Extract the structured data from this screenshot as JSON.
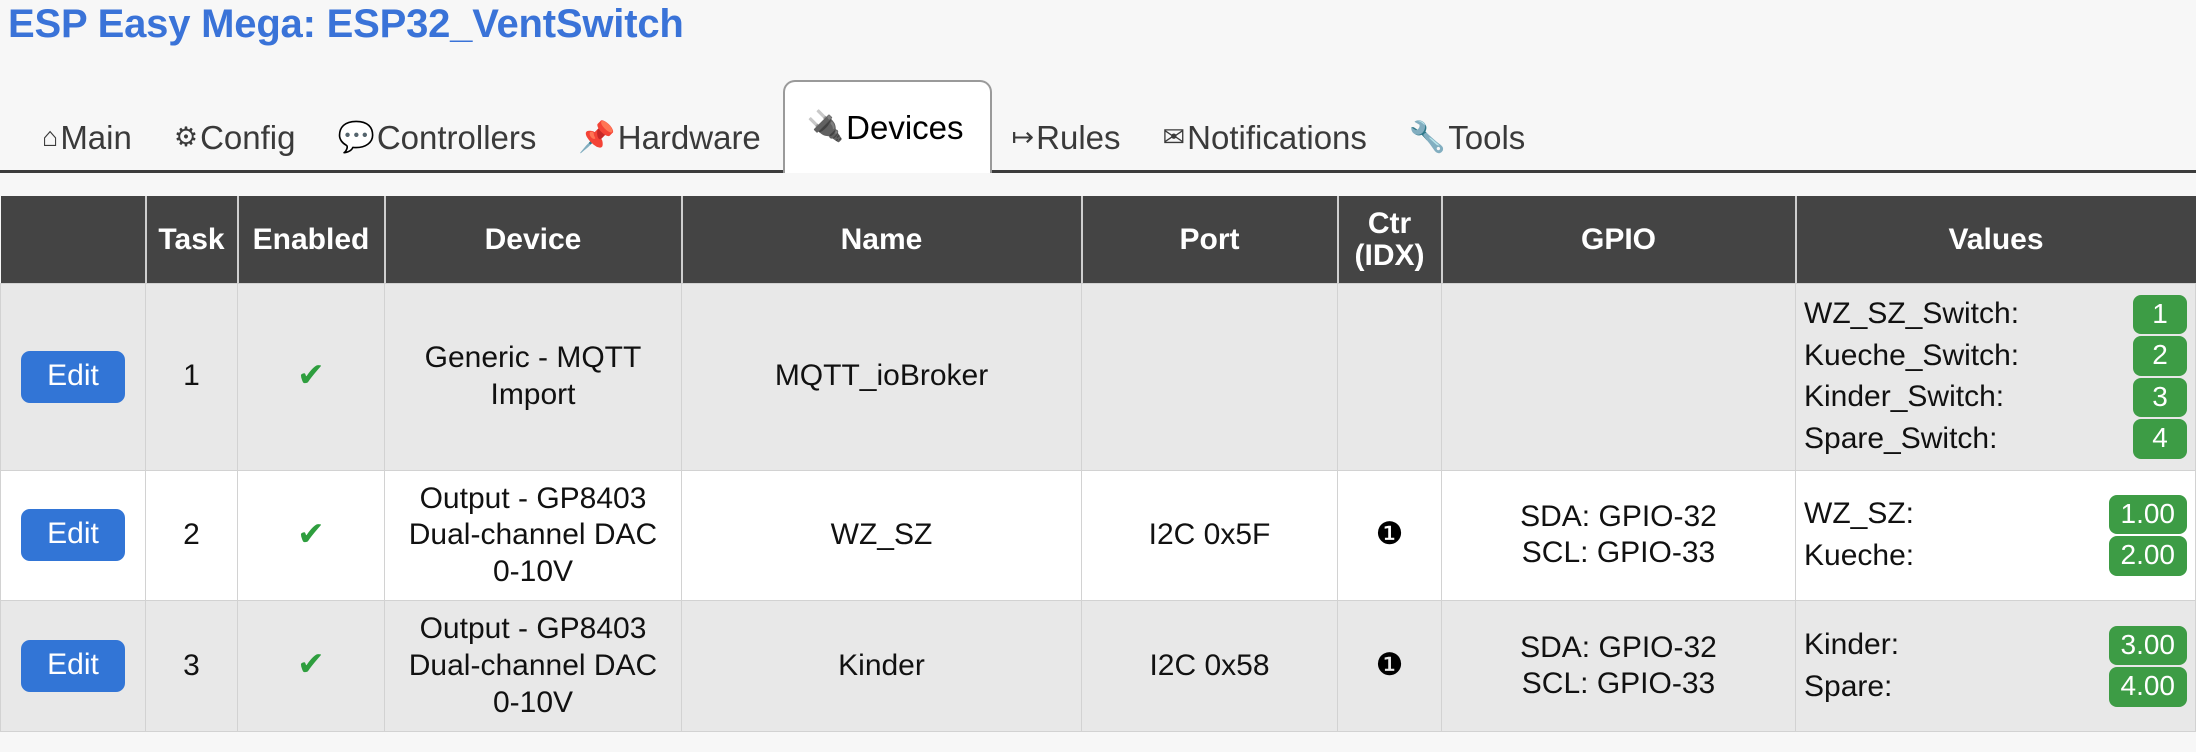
{
  "header": {
    "title": "ESP Easy Mega: ESP32_VentSwitch",
    "title_color": "#3a73d8"
  },
  "nav": {
    "tabs": [
      {
        "label": "Main",
        "icon": "home-icon",
        "glyph": "⌂",
        "active": false
      },
      {
        "label": "Config",
        "icon": "gear-icon",
        "glyph": "⚙",
        "active": false
      },
      {
        "label": "Controllers",
        "icon": "speech-bubble-icon",
        "glyph": "💬",
        "active": false
      },
      {
        "label": "Hardware",
        "icon": "pushpin-icon",
        "glyph": "📌",
        "active": false
      },
      {
        "label": "Devices",
        "icon": "electric-plug-icon",
        "glyph": "🔌",
        "active": true
      },
      {
        "label": "Rules",
        "icon": "arrow-right-icon",
        "glyph": "↦",
        "active": false
      },
      {
        "label": "Notifications",
        "icon": "envelope-icon",
        "glyph": "✉",
        "active": false
      },
      {
        "label": "Tools",
        "icon": "wrench-icon",
        "glyph": "🔧",
        "active": false
      }
    ]
  },
  "table": {
    "columns": [
      {
        "key": "edit",
        "label": ""
      },
      {
        "key": "task",
        "label": "Task"
      },
      {
        "key": "enabled",
        "label": "Enabled"
      },
      {
        "key": "device",
        "label": "Device"
      },
      {
        "key": "name",
        "label": "Name"
      },
      {
        "key": "port",
        "label": "Port"
      },
      {
        "key": "ctr",
        "label": "Ctr\n(IDX)"
      },
      {
        "key": "gpio",
        "label": "GPIO"
      },
      {
        "key": "values",
        "label": "Values"
      }
    ],
    "edit_label": "Edit",
    "enabled_glyph": "✔",
    "rows": [
      {
        "task": "1",
        "enabled": true,
        "device": "Generic - MQTT\nImport",
        "name": "MQTT_ioBroker",
        "port": "",
        "ctr": "",
        "gpio": "",
        "values": [
          {
            "label": "WZ_SZ_Switch:",
            "value": "1"
          },
          {
            "label": "Kueche_Switch:",
            "value": "2"
          },
          {
            "label": "Kinder_Switch:",
            "value": "3"
          },
          {
            "label": "Spare_Switch:",
            "value": "4"
          }
        ]
      },
      {
        "task": "2",
        "enabled": true,
        "device": "Output - GP8403\nDual-channel DAC\n0-10V",
        "name": "WZ_SZ",
        "port": "I2C 0x5F",
        "ctr": "❶",
        "gpio": "SDA: GPIO-32\nSCL: GPIO-33",
        "values": [
          {
            "label": "WZ_SZ:",
            "value": "1.00"
          },
          {
            "label": "Kueche:",
            "value": "2.00"
          }
        ]
      },
      {
        "task": "3",
        "enabled": true,
        "device": "Output - GP8403\nDual-channel DAC\n0-10V",
        "name": "Kinder",
        "port": "I2C 0x58",
        "ctr": "❶",
        "gpio": "SDA: GPIO-32\nSCL: GPIO-33",
        "values": [
          {
            "label": "Kinder:",
            "value": "3.00"
          },
          {
            "label": "Spare:",
            "value": "4.00"
          }
        ]
      }
    ]
  },
  "colors": {
    "header_bg": "#444444",
    "edit_button": "#3275d6",
    "value_badge": "#3d9c45",
    "check_mark": "#2e9e3e"
  }
}
